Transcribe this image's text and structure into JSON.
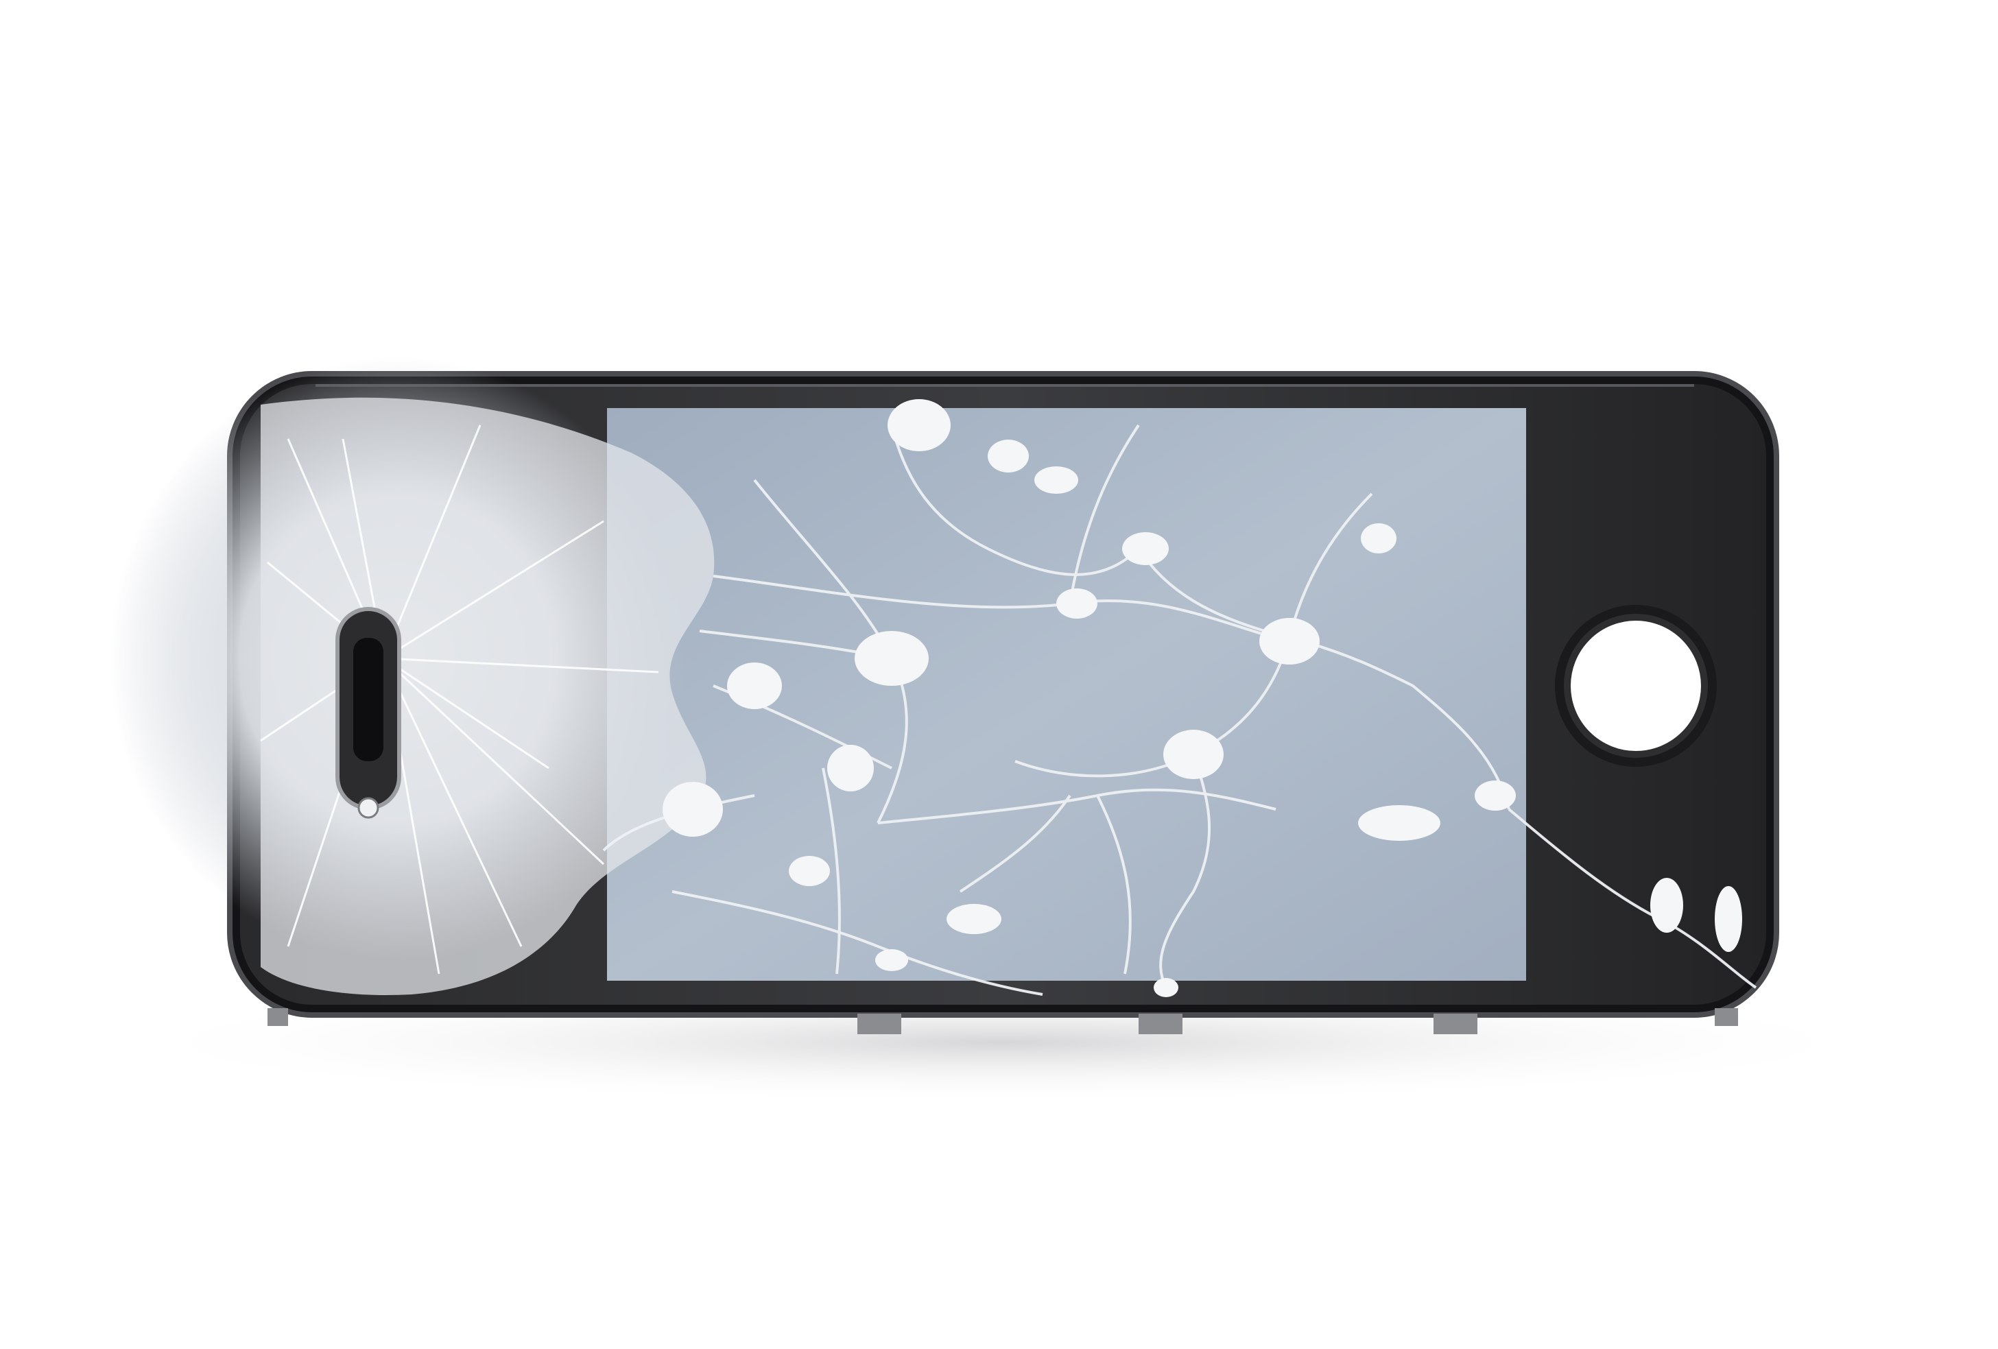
{
  "scene": {
    "subject": "cracked-phone-front-panel",
    "colors": {
      "background": "#ffffff",
      "bezel": "#1c1c1e",
      "frame_edge": "#3a3a3c",
      "screen_glass": "#a9b5c4",
      "screen_glass_light": "#c5cfdb",
      "crack_white": "#f2f4f6",
      "shatter_zone": "#d7dbe0",
      "shadow": "#e9e9ea"
    },
    "icons": [
      "earpiece-speaker-icon",
      "front-camera-icon",
      "home-button-icon"
    ]
  }
}
